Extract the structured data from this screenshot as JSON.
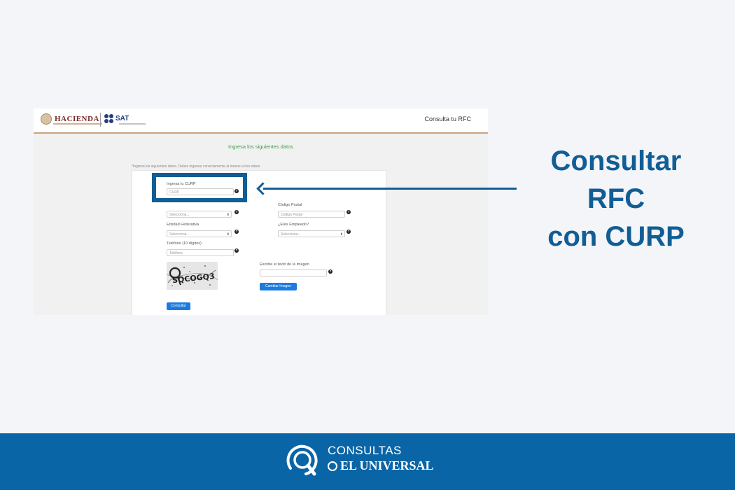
{
  "screenshot": {
    "header": {
      "hacienda_logo": "HACIENDA",
      "sat_logo": "SAT",
      "right_title": "Consulta tu RFC"
    },
    "form_title": "Ingresa los siguientes datos",
    "instructions": "*Ingresa los siguientes datos. Debes ingresar correctamente al menos a tres datos.",
    "fields": {
      "curp": {
        "label": "Ingresa tu CURP",
        "placeholder": "CURP"
      },
      "codigo_postal": {
        "label": "Código Postal",
        "placeholder": "Código Postal"
      },
      "select1": {
        "value": "Selecciona..."
      },
      "entidad": {
        "label": "Entidad Federativa",
        "value": "Selecciona..."
      },
      "empleado": {
        "label": "¿Eres Empleado?",
        "value": "Selecciona..."
      },
      "telefono": {
        "label": "Teléfono (10 dígitos)",
        "placeholder": "Teléfono"
      },
      "captcha_text": {
        "label": "Escribe el texto de la imagen",
        "placeholder": ""
      }
    },
    "captcha_image_text": "SQCOGQ3",
    "buttons": {
      "change_image": "Cambiar Imagen",
      "submit": "Consultar"
    },
    "help_icon": "?"
  },
  "caption": {
    "line1": "Consultar",
    "line2": "RFC",
    "line3": "con CURP"
  },
  "footer": {
    "brand_top": "CONSULTAS",
    "brand_bottom": "EL UNIVERSAL"
  },
  "colors": {
    "accent_blue": "#115e95",
    "footer_blue": "#0a65a6",
    "button_blue": "#1d7be0",
    "form_title_green": "#3e9e48"
  }
}
